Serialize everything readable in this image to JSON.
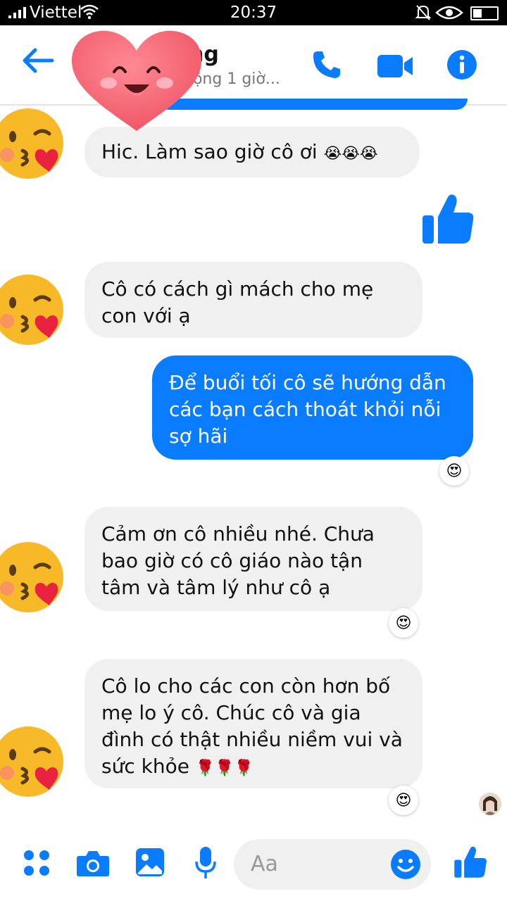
{
  "status_bar": {
    "carrier": "Viettel",
    "time": "20:37"
  },
  "header": {
    "contact_name": "ng",
    "active_status": "động 1 giờ..."
  },
  "messages": [
    {
      "side": "in",
      "text": "Hic. Làm sao giờ cô ơi",
      "emoji": "😭😭😭"
    },
    {
      "side": "out",
      "type": "like"
    },
    {
      "side": "in",
      "text": "Cô có cách gì mách cho mẹ con với ạ"
    },
    {
      "side": "out",
      "text": "Để buổi tối cô sẽ hướng dẫn các bạn cách thoát khỏi nỗi sợ hãi",
      "reaction": "😍"
    },
    {
      "side": "in",
      "text": "Cảm ơn cô nhiều nhé. Chưa bao giờ có cô giáo nào tận tâm và tâm lý như cô ạ",
      "reaction": "😍"
    },
    {
      "side": "in",
      "text": "Cô lo cho các con còn hơn bố mẹ lo ý cô. Chúc cô và gia đình có thật nhiều niềm vui và sức khỏe",
      "emoji": "🌹🌹🌹",
      "reaction": "😍"
    }
  ],
  "composer": {
    "placeholder": "Aa"
  },
  "colors": {
    "accent": "#0a7cff",
    "bubble_in": "#f0f0f0",
    "heart": "#f25c6b"
  },
  "icons": [
    "back-arrow-icon",
    "phone-icon",
    "video-icon",
    "info-icon",
    "menu-grid-icon",
    "camera-icon",
    "gallery-icon",
    "microphone-icon",
    "smiley-icon",
    "thumbs-up-icon"
  ]
}
